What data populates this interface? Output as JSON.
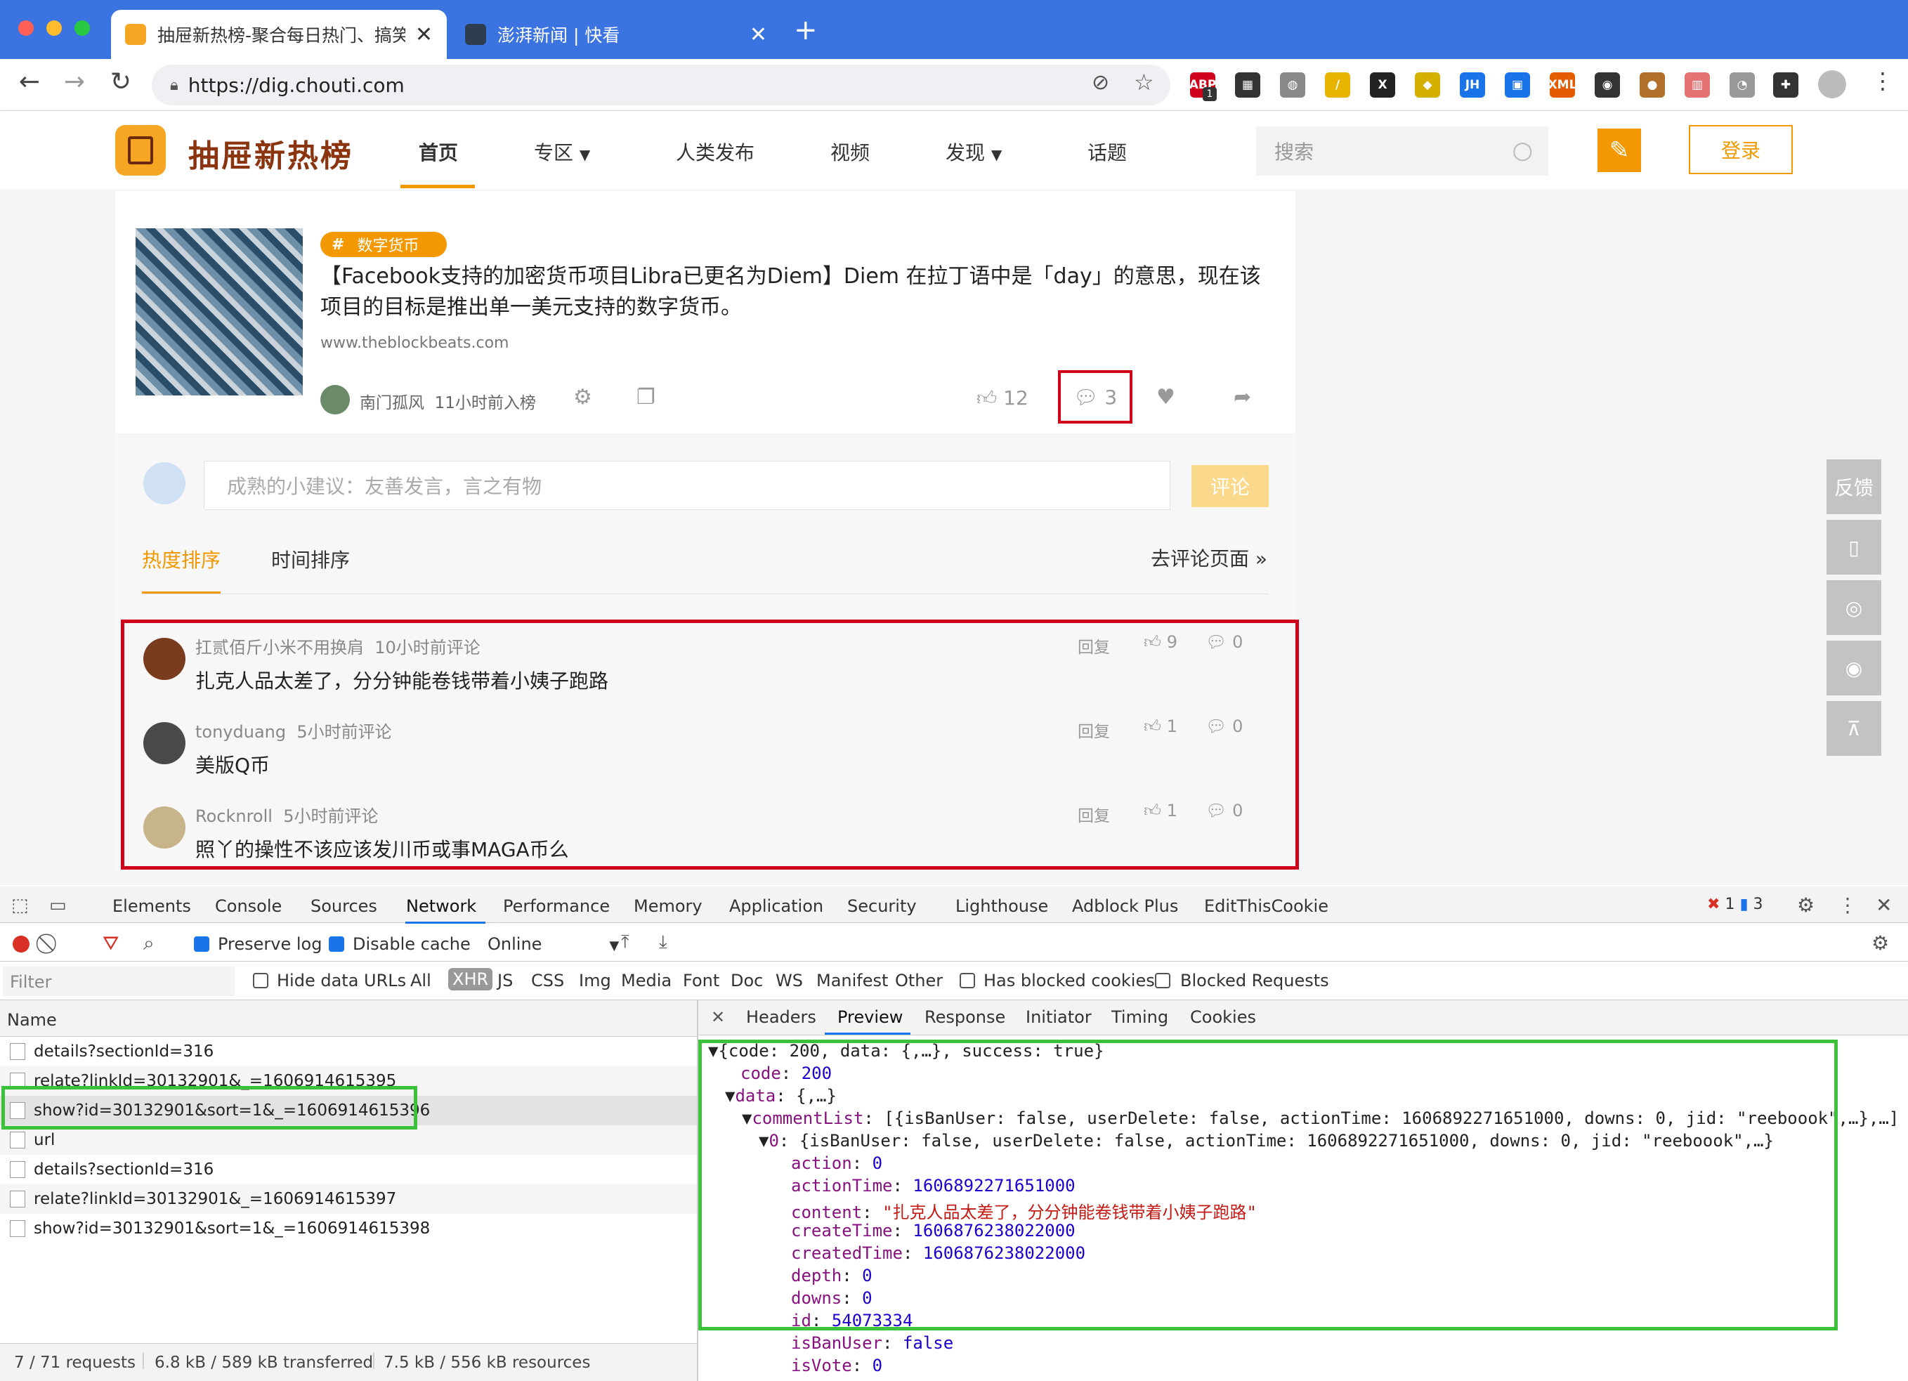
{
  "browser": {
    "tabs": [
      {
        "title": "抽屉新热榜-聚合每日热门、搞笑",
        "active": true
      },
      {
        "title": "澎湃新闻 | 快看",
        "active": false
      }
    ],
    "new_tab": "+",
    "url": "https://dig.chouti.com",
    "extensions": [
      {
        "label": "ABP",
        "badge": "1",
        "color": "#d0021b"
      },
      {
        "label": "▦",
        "color": "#333"
      },
      {
        "label": "◍",
        "color": "#888"
      },
      {
        "label": "/",
        "color": "#e8b400"
      },
      {
        "label": "X",
        "color": "#222"
      },
      {
        "label": "◆",
        "color": "#d4b000"
      },
      {
        "label": "JH",
        "color": "#1a73e8"
      },
      {
        "label": "▣",
        "color": "#1a73e8"
      },
      {
        "label": "XML",
        "color": "#e35d00"
      },
      {
        "label": "◉",
        "color": "#333"
      },
      {
        "label": "●",
        "color": "#b3702a"
      },
      {
        "label": "▥",
        "color": "#e57373"
      },
      {
        "label": "◔",
        "color": "#999"
      },
      {
        "label": "✚",
        "color": "#333"
      }
    ]
  },
  "site": {
    "logo_text": "抽屉新热榜",
    "nav": [
      "首页",
      "专区",
      "人类发布",
      "视频",
      "发现",
      "话题"
    ],
    "search_placeholder": "搜索",
    "login_label": "登录"
  },
  "post": {
    "tag": "数字货币",
    "headline": "【Facebook支持的加密货币项目Libra已更名为Diem】Diem 在拉丁语中是「day」的意思，现在该项目的目标是推出单一美元支持的数字货币。",
    "source": "www.theblockbeats.com",
    "author": "南门孤风",
    "time": "11小时前入榜",
    "likes": "12",
    "comments": "3"
  },
  "comment_box": {
    "placeholder": "成熟的小建议：友善发言，言之有物",
    "submit_label": "评论",
    "sort_hot": "热度排序",
    "sort_time": "时间排序",
    "goto_label": "去评论页面 »"
  },
  "comments": [
    {
      "user": "扛贰佰斤小米不用换肩",
      "time": "10小时前评论",
      "text": "扎克人品太差了，分分钟能卷钱带着小姨子跑路",
      "reply": "回复",
      "up": "9",
      "down": "0",
      "avatar_color": "#7a3c1e"
    },
    {
      "user": "tonyduang",
      "time": "5小时前评论",
      "text": "美版Q币",
      "reply": "回复",
      "up": "1",
      "down": "0",
      "avatar_color": "#4a4a4a"
    },
    {
      "user": "Rocknroll",
      "time": "5小时前评论",
      "text": "照丫的操性不该应该发川币或事MAGA币么",
      "reply": "回复",
      "up": "1",
      "down": "0",
      "avatar_color": "#c8b48a"
    }
  ],
  "side_buttons": [
    "反馈",
    "▯",
    "◎",
    "◉",
    "⊼"
  ],
  "devtools": {
    "tabs": [
      "Elements",
      "Console",
      "Sources",
      "Network",
      "Performance",
      "Memory",
      "Application",
      "Security",
      "Lighthouse",
      "Adblock Plus",
      "EditThisCookie"
    ],
    "active_tab": "Network",
    "errors": "1",
    "messages": "3",
    "preserve_log": "Preserve log",
    "disable_cache": "Disable cache",
    "throttle": "Online",
    "filter_placeholder": "Filter",
    "hide_data_urls": "Hide data URLs",
    "type_filters": [
      "All",
      "XHR",
      "JS",
      "CSS",
      "Img",
      "Media",
      "Font",
      "Doc",
      "WS",
      "Manifest",
      "Other"
    ],
    "active_type": "XHR",
    "has_blocked": "Has blocked cookies",
    "blocked_requests": "Blocked Requests",
    "name_header": "Name",
    "requests": [
      "details?sectionId=316",
      "relate?linkId=30132901&_=1606914615395",
      "show?id=30132901&sort=1&_=1606914615396",
      "url",
      "details?sectionId=316",
      "relate?linkId=30132901&_=1606914615397",
      "show?id=30132901&sort=1&_=1606914615398"
    ],
    "detail_tabs": [
      "Headers",
      "Preview",
      "Response",
      "Initiator",
      "Timing",
      "Cookies"
    ],
    "active_detail": "Preview",
    "footer": {
      "requests": "7 / 71 requests",
      "transferred": "6.8 kB / 589 kB transferred",
      "resources": "7.5 kB / 556 kB resources"
    },
    "preview": {
      "root": "{code: 200, data: {,…}, success: true}",
      "code_key": "code",
      "code_val": "200",
      "data_key": "data",
      "data_val": "{,…}",
      "list_key": "commentList",
      "list_val": "[{isBanUser: false, userDelete: false, actionTime: 1606892271651000, downs: 0, jid: \"reeboook\",…},…]",
      "item_key": "0",
      "item_val": "{isBanUser: false, userDelete: false, actionTime: 1606892271651000, downs: 0, jid: \"reeboook\",…}",
      "fields": [
        {
          "k": "action",
          "v": "0",
          "t": "n"
        },
        {
          "k": "actionTime",
          "v": "1606892271651000",
          "t": "n"
        },
        {
          "k": "content",
          "v": "\"扎克人品太差了，分分钟能卷钱带着小姨子跑路\"",
          "t": "s"
        },
        {
          "k": "createTime",
          "v": "1606876238022000",
          "t": "n"
        },
        {
          "k": "createdTime",
          "v": "1606876238022000",
          "t": "n"
        },
        {
          "k": "depth",
          "v": "0",
          "t": "n"
        },
        {
          "k": "downs",
          "v": "0",
          "t": "n"
        },
        {
          "k": "id",
          "v": "54073334",
          "t": "n"
        },
        {
          "k": "isBanUser",
          "v": "false",
          "t": "n"
        },
        {
          "k": "isVote",
          "v": "0",
          "t": "n"
        }
      ]
    }
  }
}
